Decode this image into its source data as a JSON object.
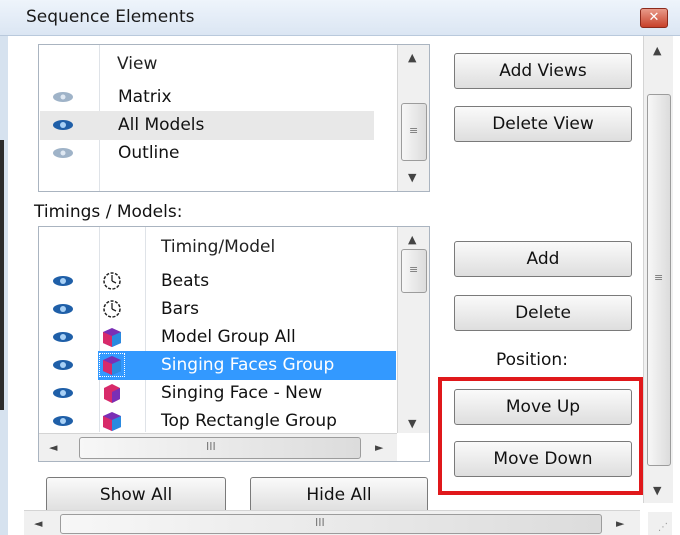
{
  "window": {
    "title": "Sequence Elements",
    "close_glyph": "✕"
  },
  "views": {
    "header": "View",
    "items": [
      {
        "label": "Matrix",
        "visible": false
      },
      {
        "label": "All Models",
        "visible": true
      },
      {
        "label": "Outline",
        "visible": false
      }
    ],
    "add_button": "Add Views",
    "delete_button": "Delete View"
  },
  "timings": {
    "section_label": "Timings / Models:",
    "header": "Timing/Model",
    "items": [
      {
        "label": "Beats",
        "icon": "timing-clock-icon"
      },
      {
        "label": "Bars",
        "icon": "timing-clock-icon"
      },
      {
        "label": "Model Group All",
        "icon": "model-group-icon"
      },
      {
        "label": "Singing Faces Group",
        "icon": "model-group-icon"
      },
      {
        "label": "Singing Face - New",
        "icon": "model-icon"
      },
      {
        "label": "Top Rectangle Group",
        "icon": "model-group-icon"
      }
    ],
    "selected_index": 3,
    "add_button": "Add",
    "delete_button": "Delete",
    "position_label": "Position:",
    "move_up_button": "Move Up",
    "move_down_button": "Move Down"
  },
  "bottom": {
    "show_all_button": "Show All",
    "hide_all_button": "Hide All"
  },
  "scroll_glyphs": {
    "up": "▲",
    "down": "▼",
    "left": "◄",
    "right": "►",
    "grip_h": "III",
    "grip_v": "≡"
  },
  "colors": {
    "selection": "#3399ff",
    "highlight_box": "#e0181b",
    "eye_on": "#1f5fa8",
    "eye_off": "#9fb3c8"
  }
}
